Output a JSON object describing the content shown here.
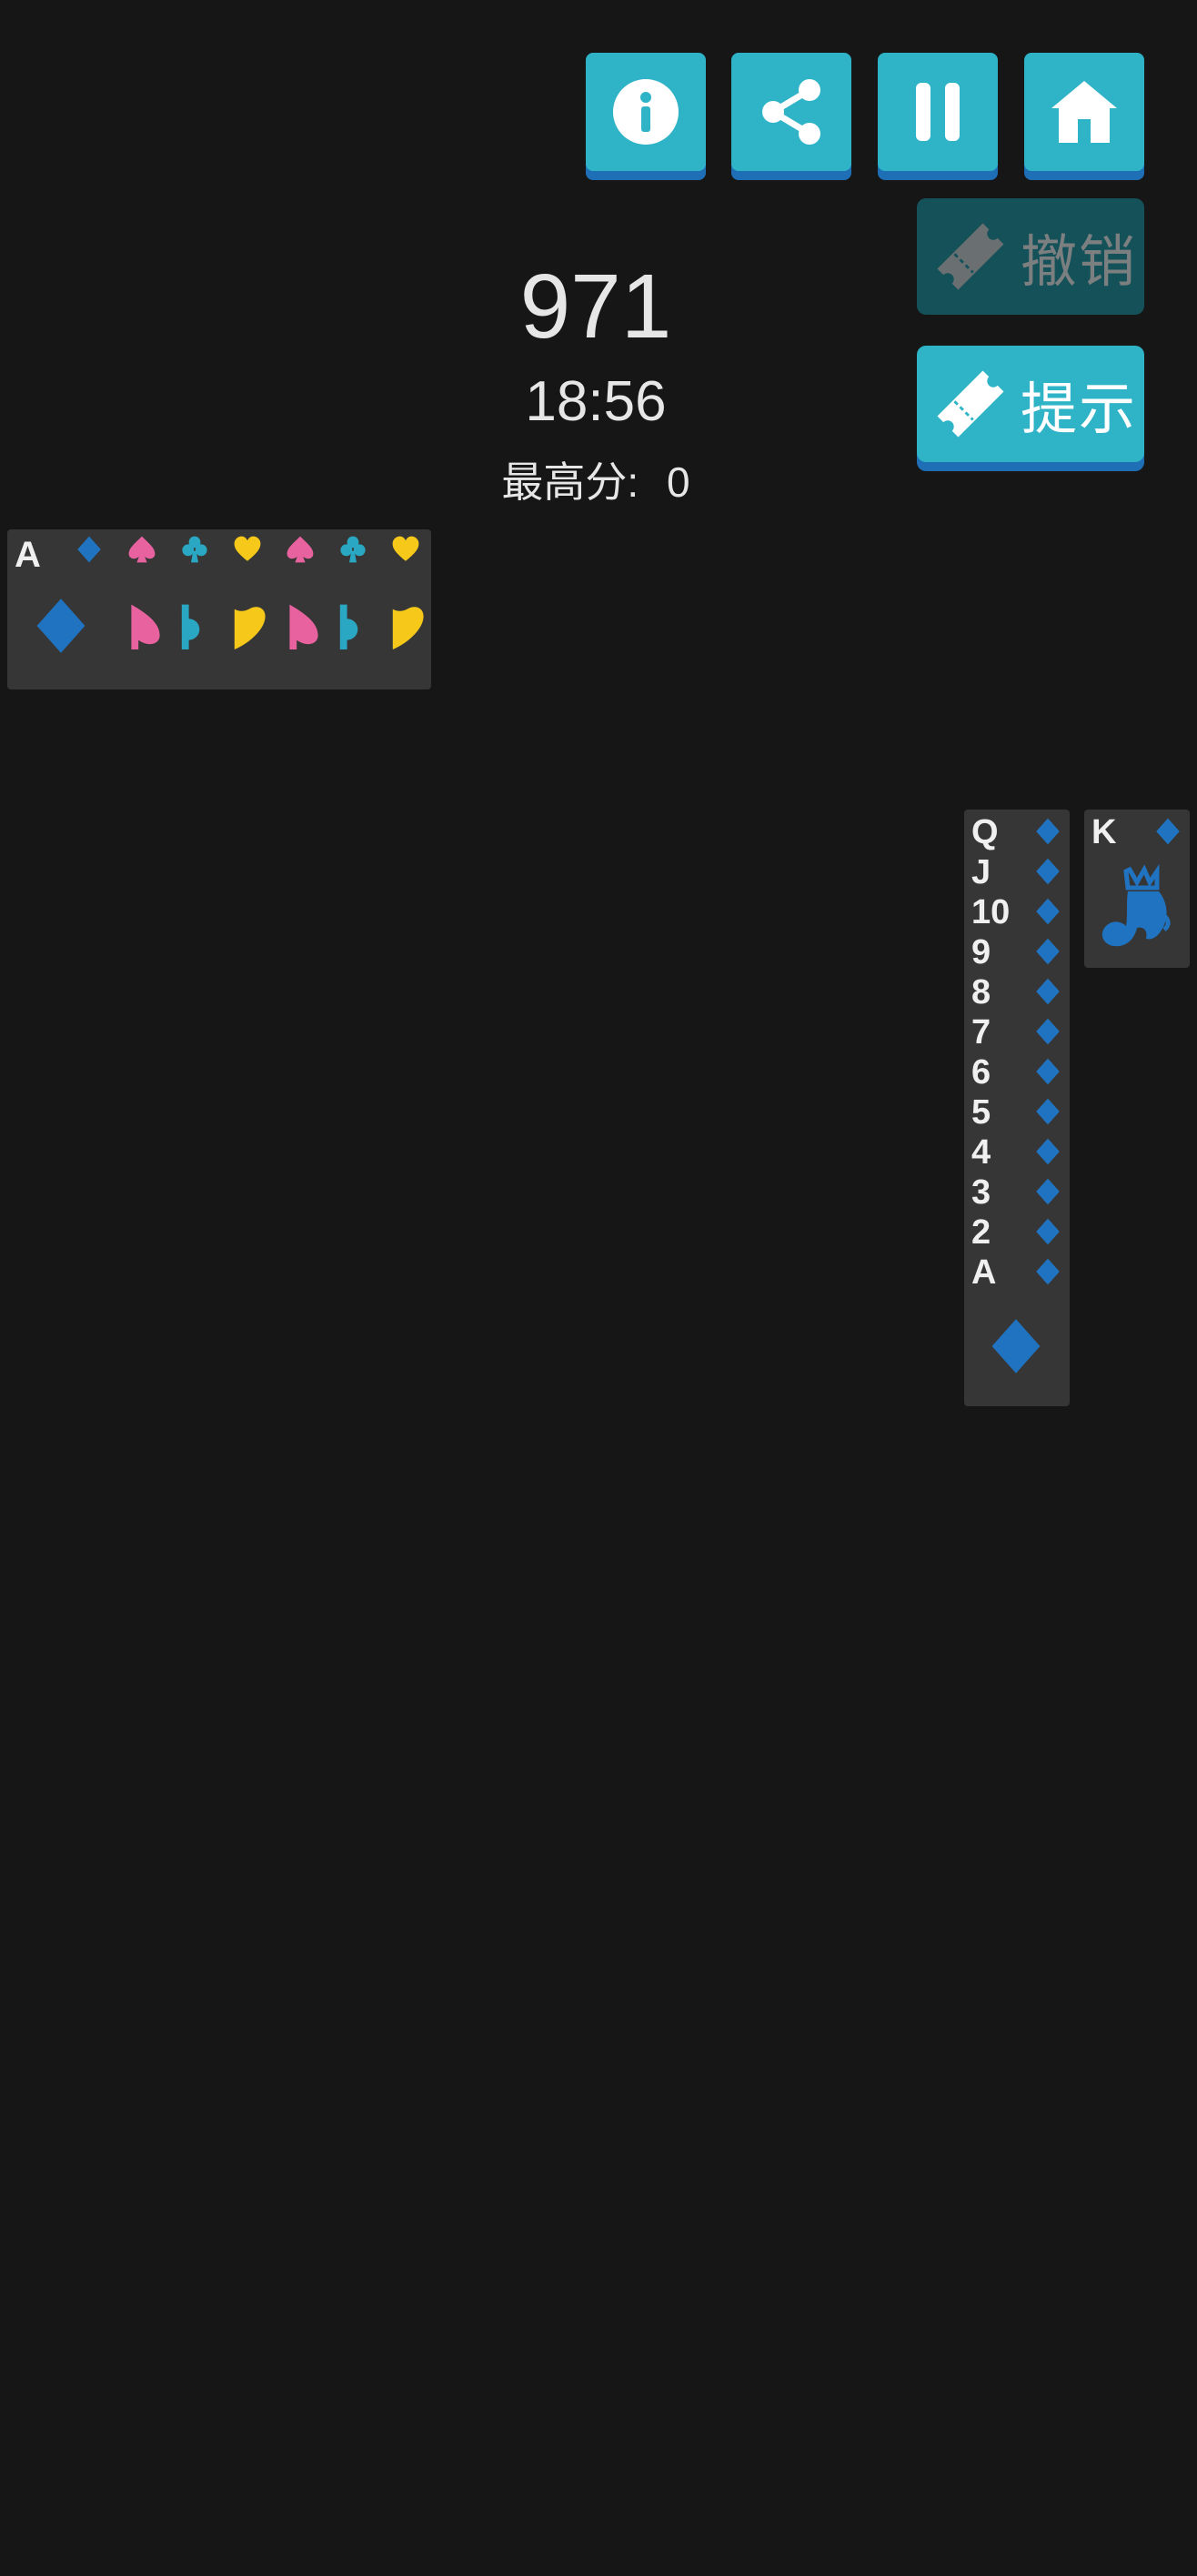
{
  "toolbar": {
    "info_icon": "info-icon",
    "share_icon": "share-icon",
    "pause_icon": "pause-icon",
    "home_icon": "home-icon"
  },
  "actions": {
    "undo_label": "撤销",
    "hint_label": "提示"
  },
  "score": {
    "value": "971",
    "time": "18:56",
    "best_label": "最高分:",
    "best_value": "0"
  },
  "piles": {
    "stack_top_rank": "A",
    "stack_suits": [
      "diamond",
      "spade",
      "club",
      "heart",
      "spade",
      "club",
      "heart"
    ],
    "column_ranks": [
      "Q",
      "J",
      "10",
      "9",
      "8",
      "7",
      "6",
      "5",
      "4",
      "3",
      "2",
      "A"
    ],
    "column_suit": "diamond",
    "king_rank": "K",
    "king_suit": "diamond"
  },
  "colors": {
    "button": "#2fb3c7",
    "button_shadow": "#1e6fb6",
    "diamond": "#1f73c0",
    "spade": "#e7629f",
    "club": "#2aa8c3",
    "heart": "#f5c81a"
  }
}
